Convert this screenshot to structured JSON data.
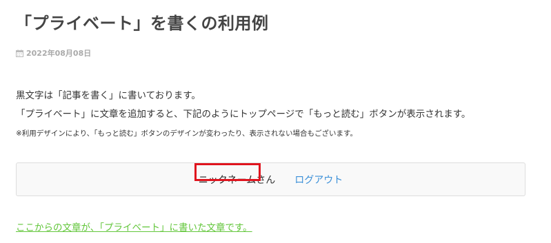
{
  "page": {
    "title": "「プライベート」を書くの利用例",
    "date": "2022年08月08日"
  },
  "content": {
    "line1": "黒文字は「記事を書く」に書いております。",
    "line2": "「プライベート」に文章を追加すると、下記のようにトップページで「もっと読む」ボタンが表示されます。",
    "note": "※利用デザインにより、「もっと読む」ボタンのデザインが変わったり、表示されない場合もございます。"
  },
  "member_box": {
    "nickname": "ニックネーム",
    "honorific": "さん",
    "logout_label": "ログアウト"
  },
  "private_link": {
    "label": "ここからの文章が、「プライベート」に書いた文章です。"
  },
  "icons": {
    "date": "calendar-icon"
  },
  "colors": {
    "highlight_border": "#e0141e",
    "logout_link": "#3a8fd8",
    "private_link": "#62c63a"
  }
}
